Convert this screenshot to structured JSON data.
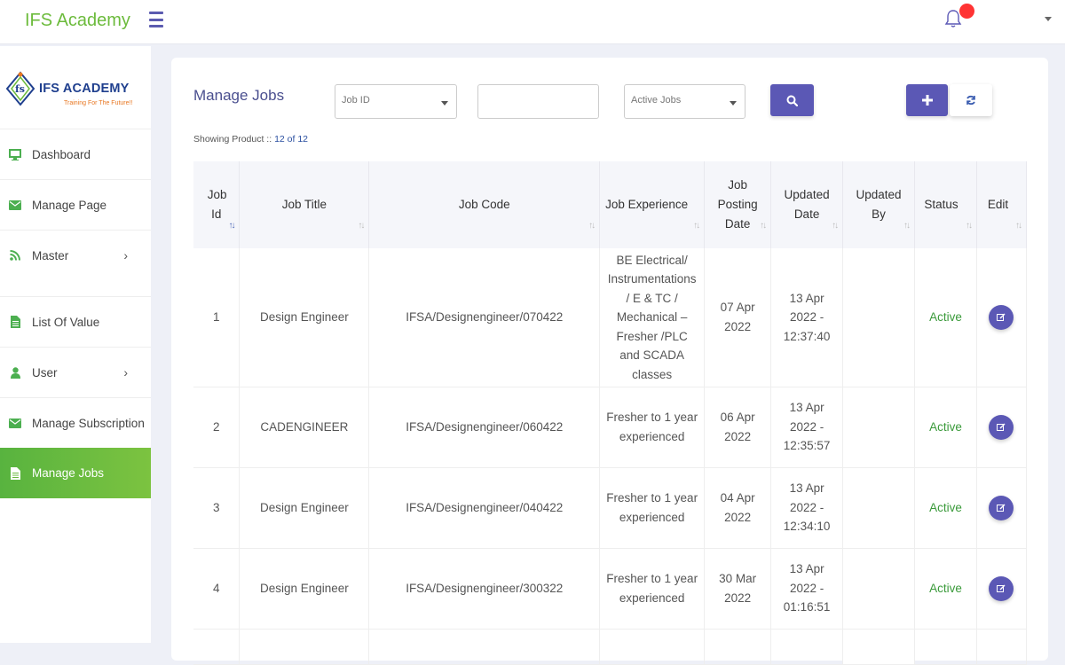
{
  "app": {
    "title": "IFS Academy"
  },
  "logo": {
    "name": "IFS ACADEMY",
    "tagline": "Training For The Future!!"
  },
  "sidebar": {
    "items": [
      {
        "label": "Dashboard",
        "icon": "monitor-icon"
      },
      {
        "label": "Manage Page",
        "icon": "envelope-icon"
      },
      {
        "label": "Master",
        "icon": "rss-icon",
        "has_submenu": true
      },
      {
        "label": "List Of Value",
        "icon": "file-icon"
      },
      {
        "label": "User",
        "icon": "user-icon",
        "has_submenu": true
      },
      {
        "label": "Manage Subscription",
        "icon": "envelope-icon"
      },
      {
        "label": "Manage Jobs",
        "icon": "file-icon",
        "active": true
      }
    ]
  },
  "page": {
    "title": "Manage Jobs",
    "filters": {
      "job_id_placeholder": "Job ID",
      "text_value": "",
      "status_value": "Active Jobs"
    },
    "showing_label": "Showing Product :: ",
    "showing_count": "12 of 12"
  },
  "table": {
    "columns": [
      "Job Id",
      "Job Title",
      "Job Code",
      "Job Experience",
      "Job Posting Date",
      "Updated Date",
      "Updated By",
      "Status",
      "Edit"
    ],
    "rows": [
      {
        "id": "1",
        "title": "Design Engineer",
        "code": "IFSA/Designengineer/070422",
        "experience": "BE Electrical/ Instrumentations / E & TC / Mechanical – Fresher /PLC and SCADA classes",
        "posting_date": "07 Apr 2022",
        "updated_date": "13 Apr 2022 - 12:37:40",
        "updated_by": "",
        "status": "Active"
      },
      {
        "id": "2",
        "title": "CADENGINEER",
        "code": "IFSA/Designengineer/060422",
        "experience": "Fresher to 1 year experienced",
        "posting_date": "06 Apr 2022",
        "updated_date": "13 Apr 2022 - 12:35:57",
        "updated_by": "",
        "status": "Active"
      },
      {
        "id": "3",
        "title": "Design Engineer",
        "code": "IFSA/Designengineer/040422",
        "experience": "Fresher to 1 year experienced",
        "posting_date": "04 Apr 2022",
        "updated_date": "13 Apr 2022 - 12:34:10",
        "updated_by": "",
        "status": "Active"
      },
      {
        "id": "4",
        "title": "Design Engineer",
        "code": "IFSA/Designengineer/300322",
        "experience": "Fresher to 1 year experienced",
        "posting_date": "30 Mar 2022",
        "updated_date": "13 Apr 2022 - 01:16:51",
        "updated_by": "",
        "status": "Active"
      }
    ]
  },
  "colors": {
    "brand_green": "#6cbb3c",
    "accent_purple": "#5b58b5",
    "status_active": "#3a9a3a",
    "notification_red": "#ff3333"
  }
}
